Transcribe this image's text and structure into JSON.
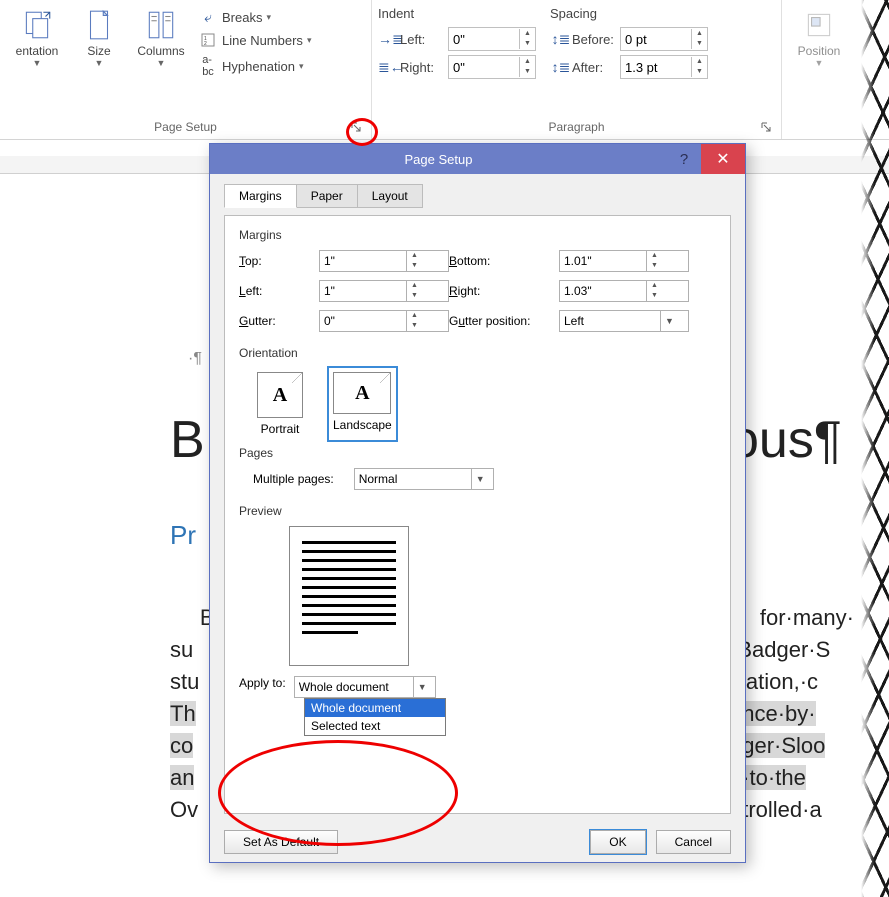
{
  "ribbon": {
    "orientation_label": "entation",
    "size_label": "Size",
    "columns_label": "Columns",
    "breaks_label": "Breaks",
    "line_numbers_label": "Line Numbers",
    "hyphenation_label": "Hyphenation",
    "page_setup_group": "Page Setup",
    "indent_header": "Indent",
    "indent_left_label": "Left:",
    "indent_left_value": "0\"",
    "indent_right_label": "Right:",
    "indent_right_value": "0\"",
    "spacing_header": "Spacing",
    "spacing_before_label": "Before:",
    "spacing_before_value": "0 pt",
    "spacing_after_label": "After:",
    "spacing_after_value": "1.3 pt",
    "paragraph_group": "Paragraph",
    "position_label": "Position"
  },
  "doc": {
    "title_left": "B",
    "title_right": "ous¶",
    "h2_left": "Pr",
    "body_lines_left": [
      "Ba",
      "su",
      "stu",
      "Th",
      "co",
      "an",
      "Ov"
    ],
    "body_lines_right": [
      "for·many·",
      "·Badger·S",
      "ication,·c",
      "ence·by·",
      "dger·Sloo",
      "e·to·the",
      "ntrolled·a"
    ]
  },
  "dialog": {
    "title": "Page Setup",
    "tabs": {
      "margins": "Margins",
      "paper": "Paper",
      "layout": "Layout"
    },
    "sections": {
      "margins": "Margins",
      "orientation": "Orientation",
      "pages": "Pages",
      "preview": "Preview"
    },
    "margins": {
      "top_label": "Top:",
      "top_value": "1\"",
      "bottom_label": "Bottom:",
      "bottom_value": "1.01\"",
      "left_label": "Left:",
      "left_value": "1\"",
      "right_label": "Right:",
      "right_value": "1.03\"",
      "gutter_label": "Gutter:",
      "gutter_value": "0\"",
      "gutter_pos_label": "Gutter position:",
      "gutter_pos_value": "Left"
    },
    "orientation": {
      "portrait": "Portrait",
      "landscape": "Landscape"
    },
    "pages_label": "Multiple pages:",
    "pages_value": "Normal",
    "apply_label": "Apply to:",
    "apply_value": "Whole document",
    "apply_options": [
      "Whole document",
      "Selected text"
    ],
    "footer": {
      "set_default": "Set As Default",
      "ok": "OK",
      "cancel": "Cancel"
    }
  }
}
